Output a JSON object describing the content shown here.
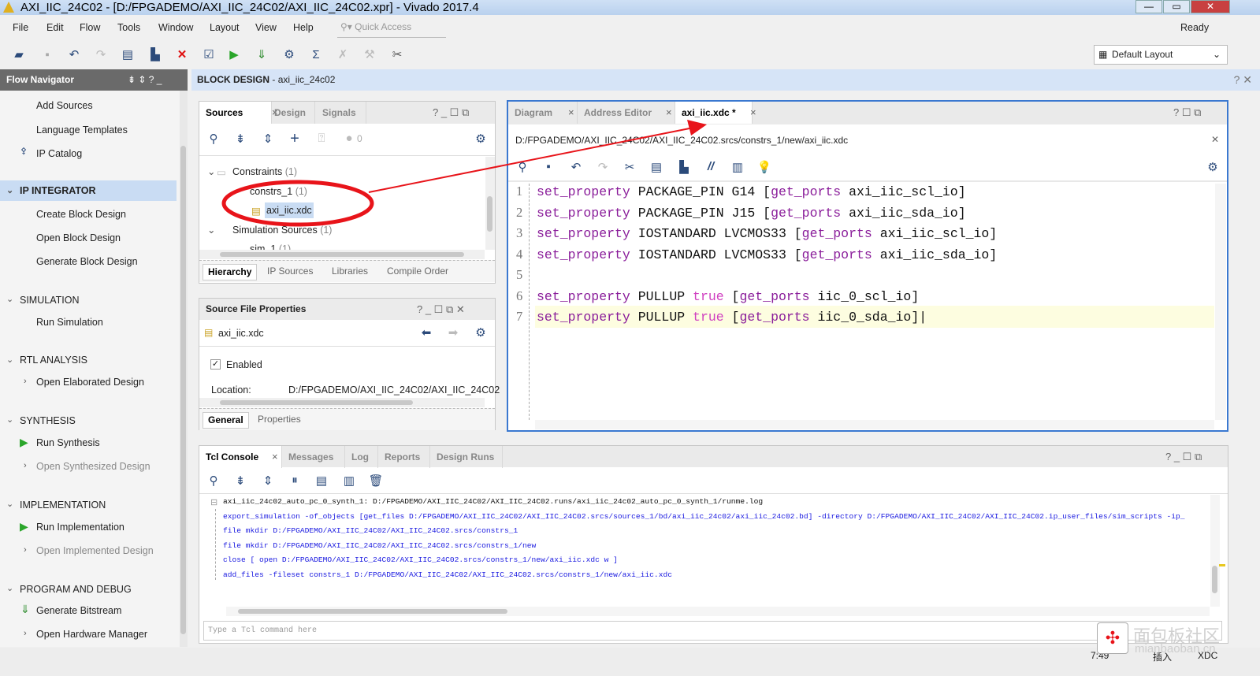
{
  "window": {
    "title": "AXI_IIC_24C02 - [D:/FPGADEMO/AXI_IIC_24C02/AXI_IIC_24C02.xpr] - Vivado 2017.4",
    "buttons": [
      "minimize",
      "maximize",
      "close"
    ]
  },
  "menu": [
    "File",
    "Edit",
    "Flow",
    "Tools",
    "Window",
    "Layout",
    "View",
    "Help"
  ],
  "quick_access_placeholder": "Quick Access",
  "status_ready": "Ready",
  "layout_select": "Default Layout",
  "toolbar": [
    "open-project-icon",
    "save-icon",
    "undo-icon",
    "redo-icon",
    "copy-icon",
    "paste-icon",
    "delete-icon",
    "check-icon",
    "run-icon",
    "bitstream-icon",
    "settings-icon",
    "sigma-icon",
    "cancel-icon",
    "hammer-icon",
    "tools-icon"
  ],
  "flow_navigator": {
    "title": "Flow Navigator",
    "items": [
      {
        "type": "item",
        "label": "Add Sources"
      },
      {
        "type": "item",
        "label": "Language Templates"
      },
      {
        "type": "item",
        "label": "IP Catalog",
        "icon": "ip-catalog-icon"
      },
      {
        "type": "section",
        "label": "IP INTEGRATOR",
        "selected": true
      },
      {
        "type": "item",
        "label": "Create Block Design"
      },
      {
        "type": "item",
        "label": "Open Block Design"
      },
      {
        "type": "item",
        "label": "Generate Block Design"
      },
      {
        "type": "section",
        "label": "SIMULATION"
      },
      {
        "type": "item",
        "label": "Run Simulation"
      },
      {
        "type": "section",
        "label": "RTL ANALYSIS"
      },
      {
        "type": "item",
        "label": "Open Elaborated Design",
        "expand": true
      },
      {
        "type": "section",
        "label": "SYNTHESIS"
      },
      {
        "type": "item",
        "label": "Run Synthesis",
        "icon": "run-icon"
      },
      {
        "type": "item",
        "label": "Open Synthesized Design",
        "expand": true,
        "disabled": true
      },
      {
        "type": "section",
        "label": "IMPLEMENTATION"
      },
      {
        "type": "item",
        "label": "Run Implementation",
        "icon": "run-icon"
      },
      {
        "type": "item",
        "label": "Open Implemented Design",
        "expand": true,
        "disabled": true
      },
      {
        "type": "section",
        "label": "PROGRAM AND DEBUG"
      },
      {
        "type": "item",
        "label": "Generate Bitstream",
        "icon": "bitstream-icon"
      },
      {
        "type": "item",
        "label": "Open Hardware Manager",
        "expand": true
      }
    ]
  },
  "block_design_header": {
    "label": "BLOCK DESIGN",
    "name": "axi_iic_24c02"
  },
  "sources": {
    "tabs": [
      "Sources",
      "Design",
      "Signals"
    ],
    "error_count": "0",
    "tree": [
      {
        "label": "Constraints",
        "count": "(1)"
      },
      {
        "label": "constrs_1",
        "count": "(1)"
      },
      {
        "label": "axi_iic.xdc",
        "selected": true
      },
      {
        "label": "Simulation Sources",
        "count": "(1)"
      },
      {
        "label": "sim_1",
        "count": "(1)"
      }
    ],
    "subtabs": [
      "Hierarchy",
      "IP Sources",
      "Libraries",
      "Compile Order"
    ]
  },
  "file_props": {
    "title": "Source File Properties",
    "file": "axi_iic.xdc",
    "enabled_label": "Enabled",
    "enabled": true,
    "location_label": "Location:",
    "location": "D:/FPGADEMO/AXI_IIC_24C02/AXI_IIC_24C02",
    "subtabs": [
      "General",
      "Properties"
    ]
  },
  "editor": {
    "tabs": [
      "Diagram",
      "Address Editor",
      "axi_iic.xdc *"
    ],
    "path": "D:/FPGADEMO/AXI_IIC_24C02/AXI_IIC_24C02.srcs/constrs_1/new/axi_iic.xdc",
    "lines": [
      [
        "set_property",
        " PACKAGE_PIN G14 ",
        "",
        "[",
        "get_ports",
        " axi_iic_scl_io]"
      ],
      [
        "set_property",
        " PACKAGE_PIN J15 ",
        "",
        "[",
        "get_ports",
        " axi_iic_sda_io]"
      ],
      [
        "set_property",
        " IOSTANDARD LVCMOS33 ",
        "",
        "[",
        "get_ports",
        " axi_iic_scl_io]"
      ],
      [
        "set_property",
        " IOSTANDARD LVCMOS33 ",
        "",
        "[",
        "get_ports",
        " axi_iic_sda_io]"
      ],
      [
        "",
        "",
        "",
        "",
        "",
        ""
      ],
      [
        "set_property",
        " PULLUP ",
        "true",
        " [",
        "get_ports",
        " iic_0_scl_io]"
      ],
      [
        "set_property",
        " PULLUP ",
        "true",
        " [",
        "get_ports",
        " iic_0_sda_io]"
      ]
    ],
    "line_numbers": [
      "1",
      "2",
      "3",
      "4",
      "5",
      "6",
      "7"
    ],
    "current_line": 7
  },
  "console": {
    "tabs": [
      "Tcl Console",
      "Messages",
      "Log",
      "Reports",
      "Design Runs"
    ],
    "lines": [
      "axi_iic_24c02_auto_pc_0_synth_1: D:/FPGADEMO/AXI_IIC_24C02/AXI_IIC_24C02.runs/axi_iic_24c02_auto_pc_0_synth_1/runme.log",
      "export_simulation -of_objects [get_files D:/FPGADEMO/AXI_IIC_24C02/AXI_IIC_24C02.srcs/sources_1/bd/axi_iic_24c02/axi_iic_24c02.bd] -directory D:/FPGADEMO/AXI_IIC_24C02/AXI_IIC_24C02.ip_user_files/sim_scripts -ip_",
      "file mkdir D:/FPGADEMO/AXI_IIC_24C02/AXI_IIC_24C02.srcs/constrs_1",
      "file mkdir D:/FPGADEMO/AXI_IIC_24C02/AXI_IIC_24C02.srcs/constrs_1/new",
      "close [ open D:/FPGADEMO/AXI_IIC_24C02/AXI_IIC_24C02.srcs/constrs_1/new/axi_iic.xdc w ]",
      "add_files -fileset constrs_1 D:/FPGADEMO/AXI_IIC_24C02/AXI_IIC_24C02.srcs/constrs_1/new/axi_iic.xdc"
    ],
    "input_placeholder": "Type a Tcl command here"
  },
  "statusbar": {
    "position": "7:49",
    "mode": "插入",
    "filetype": "XDC"
  },
  "watermark": {
    "text": "面包板社区",
    "url_text": "mianbaoban.cn"
  },
  "colors": {
    "keyword": "#8a1d9a",
    "boolean": "#d040c0",
    "console_cmd": "#1a1ae0",
    "annotation": "#e8141a",
    "selection": "#c9dcf3",
    "editor_border": "#3a78d0"
  }
}
